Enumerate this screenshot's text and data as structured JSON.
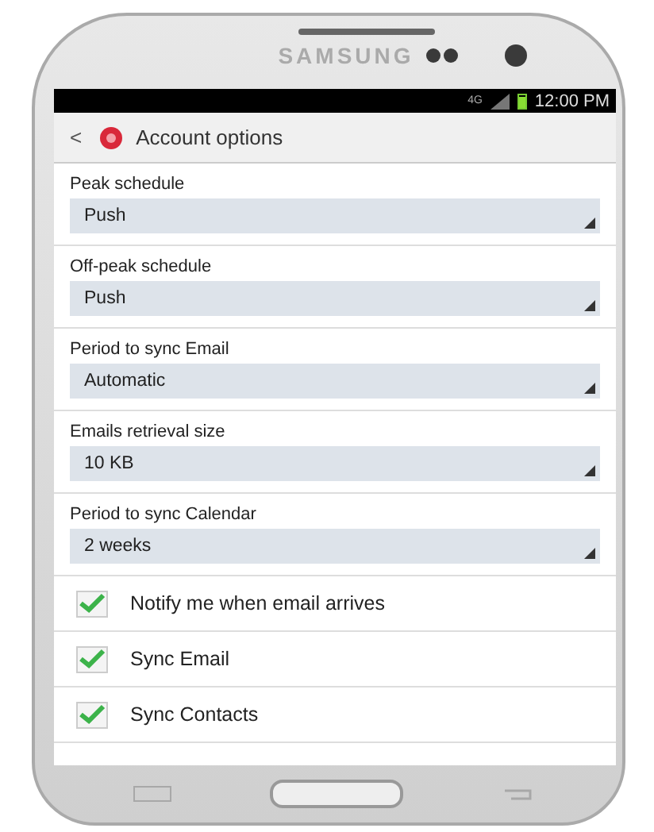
{
  "device": {
    "brand": "SAMSUNG"
  },
  "status_bar": {
    "time": "12:00 PM",
    "network": "4G"
  },
  "title_bar": {
    "back": "<",
    "title": "Account options"
  },
  "dropdowns": [
    {
      "label": "Peak schedule",
      "value": "Push"
    },
    {
      "label": "Off-peak schedule",
      "value": "Push"
    },
    {
      "label": "Period to sync Email",
      "value": "Automatic"
    },
    {
      "label": "Emails retrieval size",
      "value": "10 KB"
    },
    {
      "label": "Period to sync Calendar",
      "value": "2 weeks"
    }
  ],
  "checkboxes": [
    {
      "label": "Notify me when email arrives",
      "checked": true
    },
    {
      "label": "Sync Email",
      "checked": true
    },
    {
      "label": "Sync Contacts",
      "checked": true
    }
  ]
}
